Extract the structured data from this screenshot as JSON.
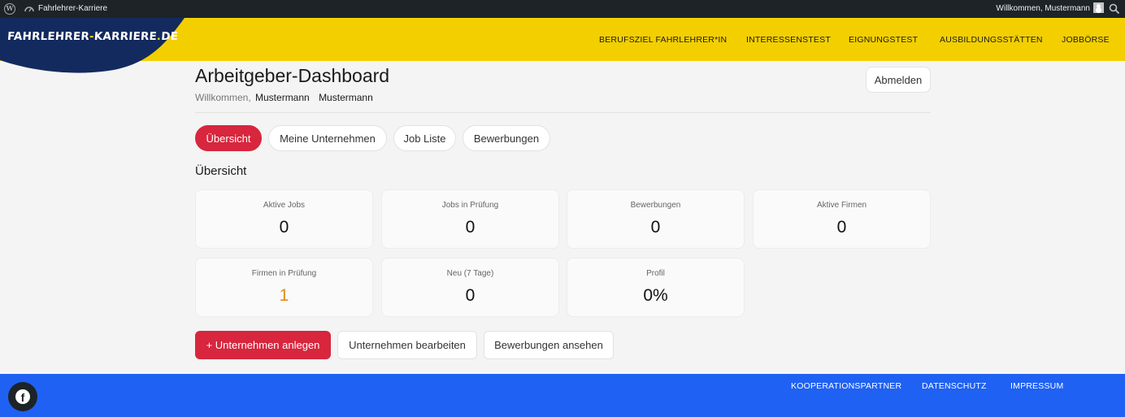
{
  "admin_bar": {
    "wp_icon": "wordpress-icon",
    "site_name": "Fahrlehrer-Karriere",
    "welcome": "Willkommen, Mustermann",
    "search_icon": "search-icon"
  },
  "header": {
    "logo_part1": "FAHRLEHRER",
    "logo_sep1": "-",
    "logo_part2": "KARRIERE",
    "logo_sep2": ".",
    "logo_part3": "DE",
    "nav": [
      {
        "label": "BERUFSZIEL FAHRLEHRER*IN"
      },
      {
        "label": "INTERESSENSTEST"
      },
      {
        "label": "EIGNUNGSTEST"
      },
      {
        "label": "AUSBILDUNGSSTÄTTEN"
      },
      {
        "label": "JOBBÖRSE"
      }
    ],
    "bg_color": "#f3cf00"
  },
  "page": {
    "title": "Arbeitgeber-Dashboard",
    "welcome_prefix": "Willkommen,",
    "first_name": "Mustermann",
    "last_name": "Mustermann",
    "logout_label": "Abmelden"
  },
  "tabs": [
    {
      "label": "Übersicht",
      "active": true
    },
    {
      "label": "Meine Unternehmen",
      "active": false
    },
    {
      "label": "Job Liste",
      "active": false
    },
    {
      "label": "Bewerbungen",
      "active": false
    }
  ],
  "overview": {
    "heading": "Übersicht",
    "stats": [
      {
        "label": "Aktive Jobs",
        "value": "0"
      },
      {
        "label": "Jobs in Prüfung",
        "value": "0"
      },
      {
        "label": "Bewerbungen",
        "value": "0"
      },
      {
        "label": "Aktive Firmen",
        "value": "0"
      },
      {
        "label": "Firmen in Prüfung",
        "value": "1",
        "color": "#e08a1e"
      },
      {
        "label": "Neu (7 Tage)",
        "value": "0"
      },
      {
        "label": "Profil",
        "value": "0%"
      }
    ]
  },
  "actions": [
    {
      "label": "+ Unternehmen anlegen",
      "primary": true
    },
    {
      "label": "Unternehmen bearbeiten",
      "primary": false
    },
    {
      "label": "Bewerbungen ansehen",
      "primary": false
    }
  ],
  "footer": {
    "social_icon": "facebook-icon",
    "links": [
      {
        "label": "KOOPERATIONSPARTNER"
      },
      {
        "label": "DATENSCHUTZ"
      },
      {
        "label": "IMPRESSUM"
      }
    ],
    "bg_color": "#1f61f2"
  },
  "accent_color": "#d7263d"
}
